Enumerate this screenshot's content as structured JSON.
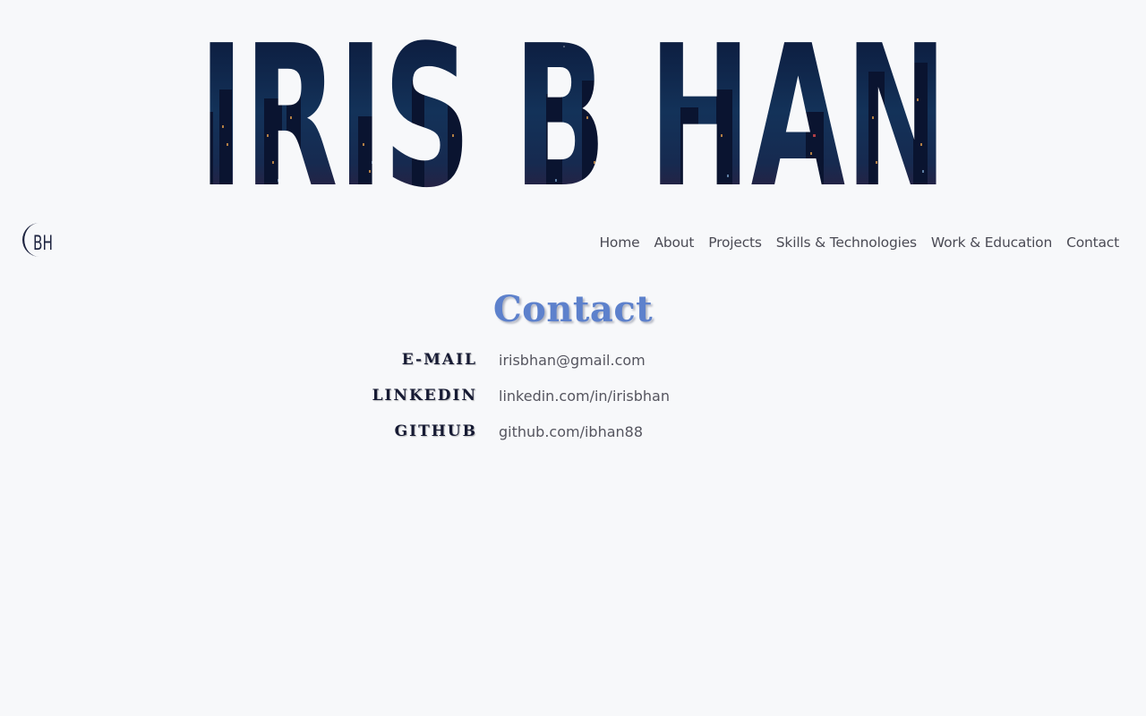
{
  "hero": {
    "title": "IRIS B HAN"
  },
  "logo": {
    "letters": "BH",
    "icon": "crescent-monogram-icon"
  },
  "nav": {
    "items": [
      {
        "label": "Home"
      },
      {
        "label": "About"
      },
      {
        "label": "Projects"
      },
      {
        "label": "Skills & Technologies"
      },
      {
        "label": "Work & Education"
      },
      {
        "label": "Contact"
      }
    ]
  },
  "contact": {
    "title": "Contact",
    "rows": [
      {
        "label": "E-MAIL",
        "value": "irisbhan@gmail.com"
      },
      {
        "label": "LINKEDIN",
        "value": "linkedin.com/in/irisbhan"
      },
      {
        "label": "GITHUB",
        "value": "github.com/ibhan88"
      }
    ]
  },
  "colors": {
    "background": "#f7f8fa",
    "accent": "#5d81cc",
    "navy": "#161a33",
    "text": "#55555f"
  }
}
